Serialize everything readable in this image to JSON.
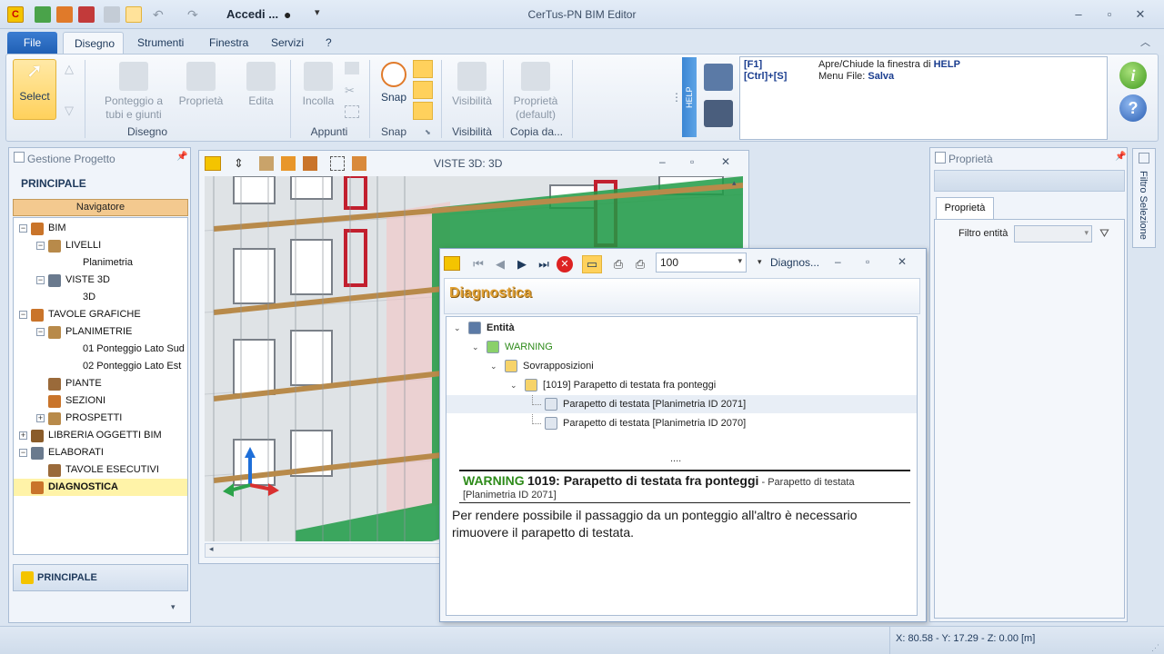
{
  "window": {
    "title": "CerTus-PN BIM Editor",
    "account_label": "Accedi ..."
  },
  "colors": {
    "accent_blue": "#2b6cc4",
    "warning_green": "#2e8b1a",
    "select_yellow": "#ffd15c",
    "highlight_row": "#fff3a8",
    "scaffold_net": "#1f9b45"
  },
  "tabs": [
    "File",
    "Disegno",
    "Strumenti",
    "Finestra",
    "Servizi",
    "?"
  ],
  "ribbon": {
    "select_label": "Select",
    "disegno_group": {
      "label": "Disegno",
      "btn_ponteggio": "Ponteggio a tubi e giunti",
      "btn_proprieta": "Proprietà",
      "btn_edita": "Edita"
    },
    "appunti_group": {
      "label": "Appunti",
      "btn_incolla": "Incolla"
    },
    "snap_group": {
      "label": "Snap",
      "btn_snap": "Snap"
    },
    "visibilita_group": {
      "label": "Visibilità",
      "btn_visibilita": "Visibilità"
    },
    "copia_group": {
      "label": "Copia da...",
      "btn_proprieta_default": "Proprietà (default)"
    },
    "help_tab": "HELP"
  },
  "help": {
    "rows": [
      {
        "key": "[F1]",
        "desc_plain": "Apre/Chiude la finestra di ",
        "desc_bold": "HELP"
      },
      {
        "key": "[Ctrl]+[S]",
        "desc_plain": "Menu File: ",
        "desc_bold": "Salva"
      }
    ]
  },
  "project_panel": {
    "title": "Gestione Progetto",
    "section": "PRINCIPALE",
    "navigator_label": "Navigatore",
    "tree": [
      {
        "label": "BIM",
        "level": 0,
        "exp": "−"
      },
      {
        "label": "LIVELLI",
        "level": 1,
        "exp": "−"
      },
      {
        "label": "Planimetria",
        "level": 2,
        "exp": ""
      },
      {
        "label": "VISTE 3D",
        "level": 1,
        "exp": "−"
      },
      {
        "label": "3D",
        "level": 2,
        "exp": ""
      },
      {
        "label": "TAVOLE GRAFICHE",
        "level": 0,
        "exp": "−"
      },
      {
        "label": "PLANIMETRIE",
        "level": 1,
        "exp": "−"
      },
      {
        "label": "01 Ponteggio Lato Sud",
        "level": 2,
        "exp": ""
      },
      {
        "label": "02 Ponteggio Lato Est",
        "level": 2,
        "exp": ""
      },
      {
        "label": "PIANTE",
        "level": 1,
        "exp": ""
      },
      {
        "label": "SEZIONI",
        "level": 1,
        "exp": ""
      },
      {
        "label": "PROSPETTI",
        "level": 1,
        "exp": "+"
      },
      {
        "label": "LIBRERIA OGGETTI BIM",
        "level": 0,
        "exp": "+"
      },
      {
        "label": "ELABORATI",
        "level": 0,
        "exp": "−"
      },
      {
        "label": "TAVOLE ESECUTIVI",
        "level": 1,
        "exp": ""
      },
      {
        "label": "DIAGNOSTICA",
        "level": 0,
        "exp": "",
        "selected": true
      }
    ],
    "footer_label": "PRINCIPALE"
  },
  "view3d": {
    "title": "VISTE 3D: 3D"
  },
  "diagnostics": {
    "window_label": "Diagnos...",
    "zoom_value": "100",
    "header": "Diagnostica",
    "tree": [
      {
        "label": "Entità",
        "level": 0,
        "bold": true
      },
      {
        "label": "WARNING",
        "level": 1,
        "green": true
      },
      {
        "label": "Sovrapposizioni",
        "level": 2
      },
      {
        "label": "[1019] Parapetto di testata fra ponteggi",
        "level": 3
      },
      {
        "label": "Parapetto di testata [Planimetria ID 2071]",
        "level": 4,
        "selected": true
      },
      {
        "label": "Parapetto di testata [Planimetria ID 2070]",
        "level": 4
      }
    ],
    "ellipsis": "....",
    "detail": {
      "severity": "WARNING",
      "code_title": "1019: Parapetto di testata fra ponteggi",
      "subtitle_1": " - Parapetto di testata",
      "subtitle_2": "[Planimetria ID 2071]",
      "message": "Per rendere possibile il passaggio da un ponteggio all'altro è necessario rimuovere il parapetto di testata."
    }
  },
  "properties": {
    "title": "Proprietà",
    "tab": "Proprietà",
    "filter_label": "Filtro entità",
    "side_tab": "Filtro Selezione"
  },
  "status": {
    "coords": "X: 80.58 - Y: 17.29 - Z: 0.00 [m]"
  }
}
